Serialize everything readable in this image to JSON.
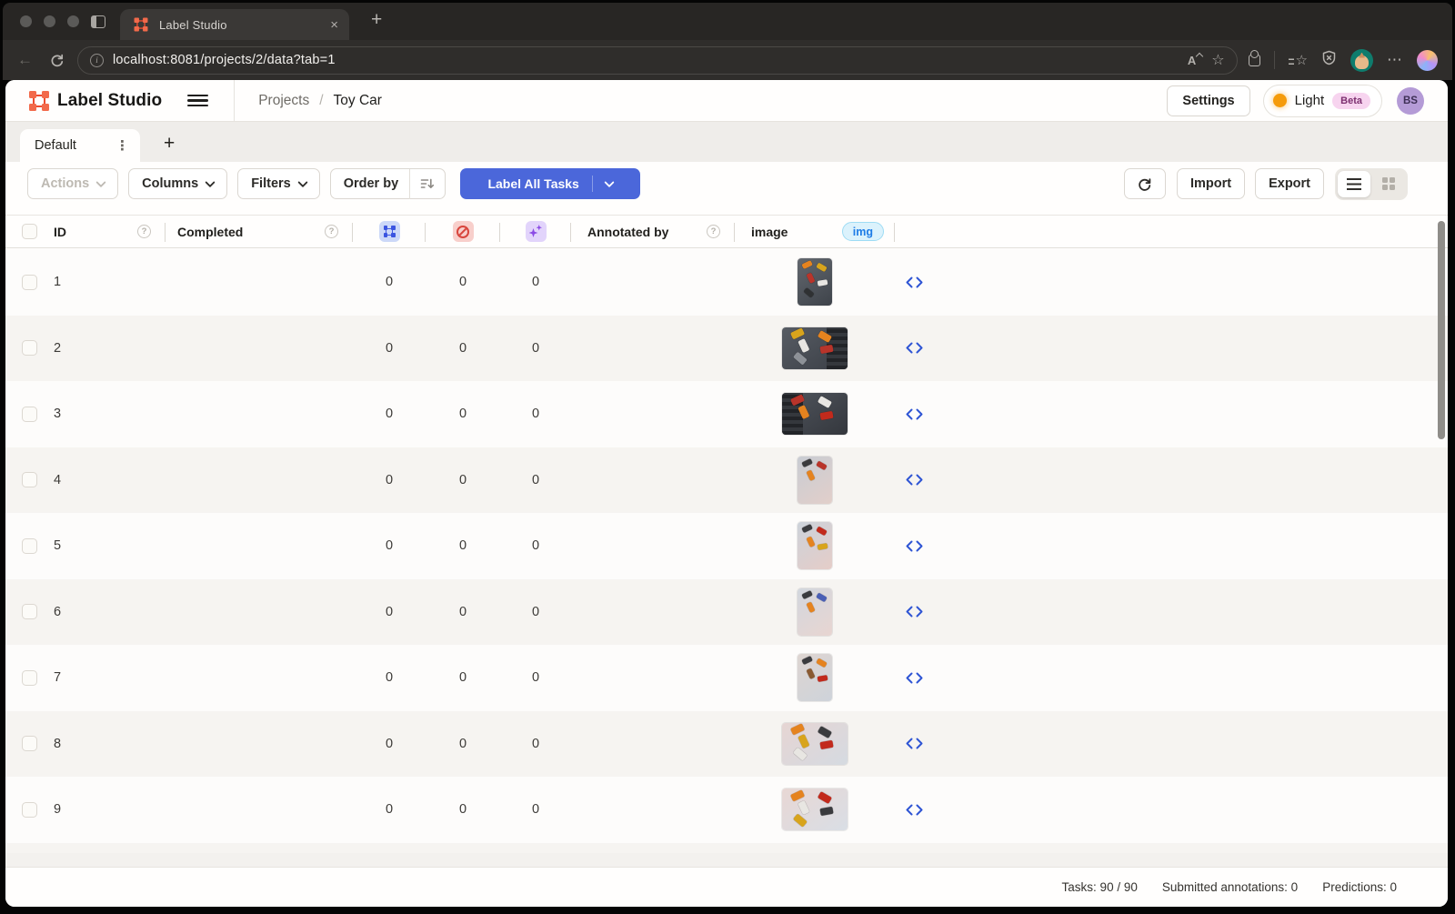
{
  "browser": {
    "tab": {
      "title": "Label Studio"
    },
    "url": "localhost:8081/projects/2/data?tab=1"
  },
  "header": {
    "logo_text": "Label Studio",
    "breadcrumb": {
      "root": "Projects",
      "separator": "/",
      "current": "Toy Car"
    },
    "settings_label": "Settings",
    "theme_toggle": {
      "label": "Light",
      "badge": "Beta"
    },
    "avatar_initials": "BS"
  },
  "view_tabs": {
    "active_tab": "Default"
  },
  "toolbar": {
    "actions_label": "Actions",
    "columns_label": "Columns",
    "filters_label": "Filters",
    "order_by_label": "Order by",
    "label_all_tasks_label": "Label All Tasks",
    "import_label": "Import",
    "export_label": "Export"
  },
  "table": {
    "headers": {
      "id": "ID",
      "completed": "Completed",
      "annotated_by": "Annotated by",
      "image": "image",
      "image_type_badge": "img"
    },
    "rows": [
      {
        "id": "1",
        "completed": "",
        "annotations": "0",
        "cancelled": "0",
        "predictions": "0",
        "annotated_by": "",
        "thumb": {
          "orientation": "p",
          "bg": [
            "#63686f",
            "#3e434a"
          ],
          "cars": [
            "#e5831f",
            "#d8a41c",
            "#b9342a",
            "#e8e6e2",
            "#2f3133"
          ]
        }
      },
      {
        "id": "2",
        "completed": "",
        "annotations": "0",
        "cancelled": "0",
        "predictions": "0",
        "annotated_by": "",
        "thumb": {
          "orientation": "l",
          "bg": [
            "#575c64",
            "#3b3f46"
          ],
          "keyboard_band": "right",
          "cars": [
            "#d8a41c",
            "#e5831f",
            "#e8e6e2",
            "#b9342a",
            "#8d9197"
          ]
        }
      },
      {
        "id": "3",
        "completed": "",
        "annotations": "0",
        "cancelled": "0",
        "predictions": "0",
        "annotated_by": "",
        "thumb": {
          "orientation": "l",
          "bg": [
            "#50555d",
            "#34373d"
          ],
          "keyboard_band": "left",
          "cars": [
            "#b9342a",
            "#e8e6e2",
            "#e5831f",
            "#c22a1c"
          ]
        }
      },
      {
        "id": "4",
        "completed": "",
        "annotations": "0",
        "cancelled": "0",
        "predictions": "0",
        "annotated_by": "",
        "thumb": {
          "orientation": "p",
          "bg": [
            "#c8ccd3",
            "#e2cfca"
          ],
          "cars": [
            "#3a3b3e",
            "#b9342a",
            "#e5831f"
          ]
        }
      },
      {
        "id": "5",
        "completed": "",
        "annotations": "0",
        "cancelled": "0",
        "predictions": "0",
        "annotated_by": "",
        "thumb": {
          "orientation": "p",
          "bg": [
            "#ccd2da",
            "#e5cdc8"
          ],
          "cars": [
            "#3a3b3e",
            "#c22a1c",
            "#e5831f",
            "#d8a41c"
          ]
        }
      },
      {
        "id": "6",
        "completed": "",
        "annotations": "0",
        "cancelled": "0",
        "predictions": "0",
        "annotated_by": "",
        "thumb": {
          "orientation": "p",
          "bg": [
            "#d2d7de",
            "#e8d5d1"
          ],
          "cars": [
            "#3a3b3e",
            "#4a5fb5",
            "#e5831f"
          ]
        }
      },
      {
        "id": "7",
        "completed": "",
        "annotations": "0",
        "cancelled": "0",
        "predictions": "0",
        "annotated_by": "",
        "thumb": {
          "orientation": "p",
          "bg": [
            "#ded5d1",
            "#ced3da"
          ],
          "cars": [
            "#3a3b3e",
            "#e5831f",
            "#8a5a32",
            "#c22a1c"
          ]
        }
      },
      {
        "id": "8",
        "completed": "",
        "annotations": "0",
        "cancelled": "0",
        "predictions": "0",
        "annotated_by": "",
        "thumb": {
          "orientation": "l",
          "bg": [
            "#e6d5d3",
            "#d5dae1"
          ],
          "cars": [
            "#e5831f",
            "#3a3b3e",
            "#d8a41c",
            "#c22a1c",
            "#e8e6e2"
          ]
        }
      },
      {
        "id": "9",
        "completed": "",
        "annotations": "0",
        "cancelled": "0",
        "predictions": "0",
        "annotated_by": "",
        "thumb": {
          "orientation": "l",
          "bg": [
            "#e8d7d4",
            "#d9dee5"
          ],
          "cars": [
            "#e5831f",
            "#c22a1c",
            "#e8e6e2",
            "#3a3b3e",
            "#d8a41c"
          ]
        }
      }
    ]
  },
  "status_bar": {
    "tasks": "Tasks: 90 / 90",
    "submitted": "Submitted annotations: 0",
    "predictions": "Predictions: 0"
  },
  "colors": {
    "accent_blue": "#4b67da",
    "brand_red": "#ee4b2e",
    "img_badge_text": "#1e7ce6",
    "beta_badge_pink": "#f7d4ef",
    "theme_dot_orange": "#f59b0a",
    "avatar_purple": "#b49bd6",
    "annotations_icon_blue": "#4059e3",
    "cancelled_icon_red": "#d8453c",
    "predictions_icon_purple": "#8b4be5"
  }
}
